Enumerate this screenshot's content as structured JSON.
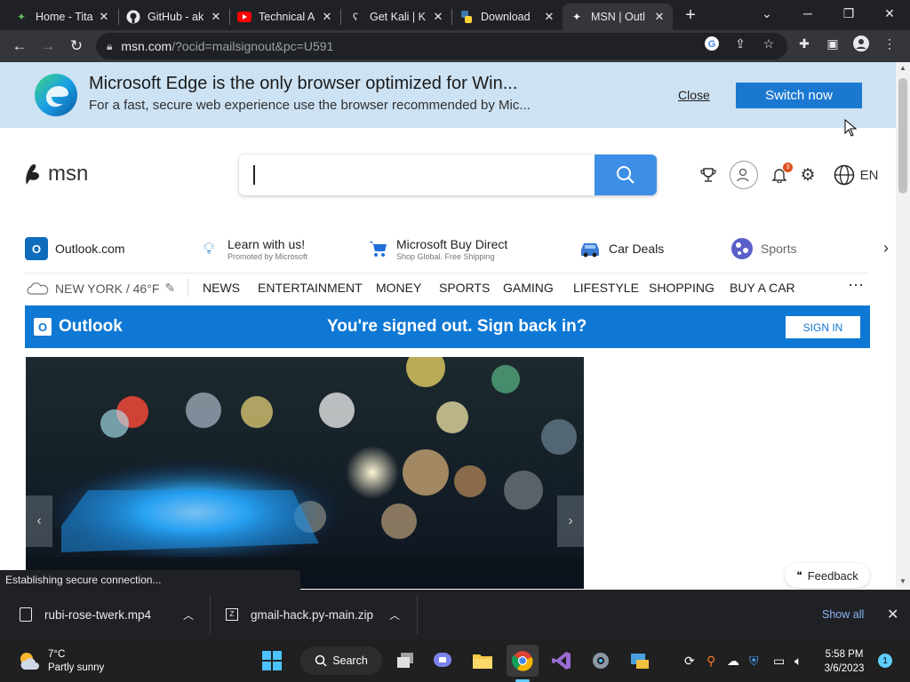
{
  "tabs": [
    {
      "title": "Home - Tita",
      "icon": "titan-leaf-icon"
    },
    {
      "title": "GitHub - ak",
      "icon": "github-icon"
    },
    {
      "title": "Technical A",
      "icon": "youtube-icon"
    },
    {
      "title": "Get Kali | K",
      "icon": "kali-icon"
    },
    {
      "title": "Download",
      "icon": "python-icon"
    },
    {
      "title": "MSN | Outl",
      "icon": "msn-icon"
    }
  ],
  "address": {
    "host": "msn.com",
    "path": "/?ocid=mailsignout&pc=U591"
  },
  "banner": {
    "title": "Microsoft Edge is the only browser optimized for Win...",
    "subtitle": "For a fast, secure web experience use the browser recommended by Mic...",
    "close_label": "Close",
    "switch_label": "Switch now"
  },
  "msn": {
    "logo_text": "msn",
    "notification_count": "3",
    "language": "EN"
  },
  "quick_links": [
    {
      "label": "Outlook.com",
      "sub": ""
    },
    {
      "label": "Learn with us!",
      "sub": "Promoted by Microsoft"
    },
    {
      "label": "Microsoft Buy Direct",
      "sub": "Shop Global. Free Shipping"
    },
    {
      "label": "Car Deals",
      "sub": ""
    },
    {
      "label": "Sports",
      "sub": ""
    }
  ],
  "weather_nav": "NEW YORK / 46°F",
  "nav": [
    "NEWS",
    "ENTERTAINMENT",
    "MONEY",
    "SPORTS",
    "GAMING",
    "LIFESTYLE",
    "SHOPPING",
    "BUY A CAR"
  ],
  "outlook_bar": {
    "brand": "Outlook",
    "message": "You're signed out. Sign back in?",
    "signin": "SIGN IN"
  },
  "feedback": "Feedback",
  "status_text": "Establishing secure connection...",
  "downloads": [
    {
      "name": "rubi-rose-twerk.mp4"
    },
    {
      "name": "gmail-hack.py-main.zip"
    }
  ],
  "show_all": "Show all",
  "taskbar": {
    "weather_temp": "7°C",
    "weather_desc": "Partly sunny",
    "search_label": "Search",
    "time": "5:58 PM",
    "date": "3/6/2023",
    "notification_badge": "1"
  }
}
